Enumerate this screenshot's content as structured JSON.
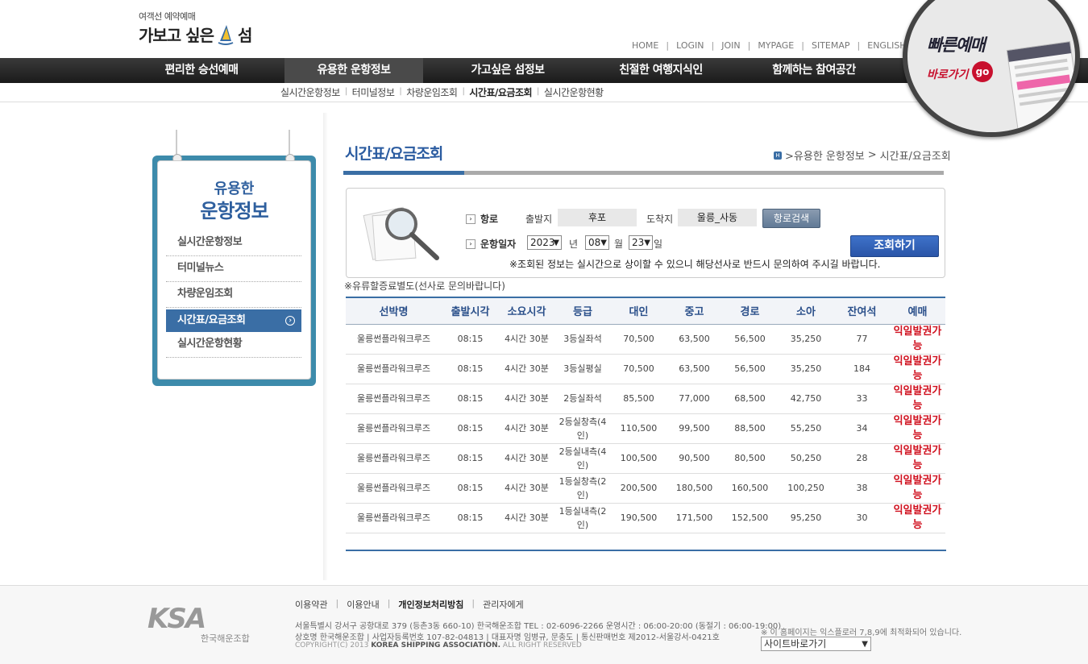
{
  "header": {
    "logo_small": "여객선 예약예매",
    "logo_main_prefix": "가보고 싶은",
    "logo_main_suffix": "섬",
    "top_links": [
      "HOME",
      "LOGIN",
      "JOIN",
      "MYPAGE",
      "SITEMAP",
      "ENGLISH"
    ],
    "gnb": [
      "편리한 승선예매",
      "유용한 운항정보",
      "가고싶은 섬정보",
      "친절한 여행지식인",
      "함께하는 참여공간"
    ],
    "gnb_active": "유용한 운항정보",
    "sub_nav": [
      "실시간운항정보",
      "터미널정보",
      "차량운임조회",
      "시간표/요금조회",
      "실시간운항현황"
    ],
    "sub_nav_active": "시간표/요금조회"
  },
  "quick": {
    "title": "빠른예매",
    "sub": "바로가기",
    "go": "go"
  },
  "lnb": {
    "title1": "유용한",
    "title2": "운항정보",
    "items": [
      {
        "label": "실시간운항정보"
      },
      {
        "label": "터미널뉴스"
      },
      {
        "label": "차량운임조회"
      },
      {
        "label": "시간표/요금조회"
      },
      {
        "label": "실시간운항현황"
      }
    ],
    "active_index": 3
  },
  "content": {
    "page_title": "시간표/요금조회",
    "breadcrumb": [
      ">유용한 운항정보",
      ">",
      "시간표/요금조회"
    ],
    "search": {
      "route_label": "항로",
      "departure_label": "출발지",
      "departure_value": "후포",
      "arrival_label": "도착지",
      "arrival_value": "울릉_사동",
      "route_search_btn": "항로검색",
      "date_label": "운항일자",
      "year": "2023",
      "year_unit": "년",
      "month": "08",
      "month_unit": "월",
      "day": "23",
      "day_unit": "일",
      "query_btn": "조회하기",
      "notice": "※조회된 정보는 실시간으로 상이할 수 있으니 해당선사로 반드시 문의하여 주시길 바랍니다."
    },
    "fuel_note": "※유류할증료별도(선사로 문의바랍니다)",
    "table": {
      "headers": [
        "선박명",
        "출발시각",
        "소요시각",
        "등급",
        "대인",
        "중고",
        "경로",
        "소아",
        "잔여석",
        "예매"
      ],
      "rows": [
        [
          "울릉썬플라워크루즈",
          "08:15",
          "4시간 30분",
          "3등실좌석",
          "70,500",
          "63,500",
          "56,500",
          "35,250",
          "77",
          "익일발권가능"
        ],
        [
          "울릉썬플라워크루즈",
          "08:15",
          "4시간 30분",
          "3등실평실",
          "70,500",
          "63,500",
          "56,500",
          "35,250",
          "184",
          "익일발권가능"
        ],
        [
          "울릉썬플라워크루즈",
          "08:15",
          "4시간 30분",
          "2등실좌석",
          "85,500",
          "77,000",
          "68,500",
          "42,750",
          "33",
          "익일발권가능"
        ],
        [
          "울릉썬플라워크루즈",
          "08:15",
          "4시간 30분",
          "2등실창측(4인)",
          "110,500",
          "99,500",
          "88,500",
          "55,250",
          "34",
          "익일발권가능"
        ],
        [
          "울릉썬플라워크루즈",
          "08:15",
          "4시간 30분",
          "2등실내측(4인)",
          "100,500",
          "90,500",
          "80,500",
          "50,250",
          "28",
          "익일발권가능"
        ],
        [
          "울릉썬플라워크루즈",
          "08:15",
          "4시간 30분",
          "1등실창측(2인)",
          "200,500",
          "180,500",
          "160,500",
          "100,250",
          "38",
          "익일발권가능"
        ],
        [
          "울릉썬플라워크루즈",
          "08:15",
          "4시간 30분",
          "1등실내측(2인)",
          "190,500",
          "171,500",
          "152,500",
          "95,250",
          "30",
          "익일발권가능"
        ]
      ]
    }
  },
  "footer": {
    "logo": "KSA",
    "logo_sub": "한국해운조합",
    "links": [
      "이용약관",
      "이용안내",
      "개인정보처리방침",
      "관리자에게"
    ],
    "bold_link": "개인정보처리방침",
    "info1": "서울특별시 강서구 공항대로 379 (등촌3동 660-10) 한국해운조합     TEL : 02-6096-2266   운영시간 : 06:00-20:00 (동절기 : 06:00-19:00)",
    "info2": "상호명 한국해운조합 | 사업자등록번호 107-82-04813 | 대표자명 임병규, 문충도 | 통신판매번호 제2012-서울강서-0421호",
    "info3_prefix": "COPYRIGHT(C) 2013",
    "info3_bold": "KOREA SHIPPING ASSOCIATION.",
    "info3_suffix": "ALL RIGHT RESERVED",
    "optimize": "※ 이 홈페이지는 익스플로러 7,8,9에 최적화되어 있습니다.",
    "site_select": "사이트바로가기"
  },
  "colors": {
    "accent_blue": "#3a6ea5",
    "title_blue": "#2a5ba0",
    "red": "#d0101e",
    "lnb_teal": "#3d8bab"
  }
}
